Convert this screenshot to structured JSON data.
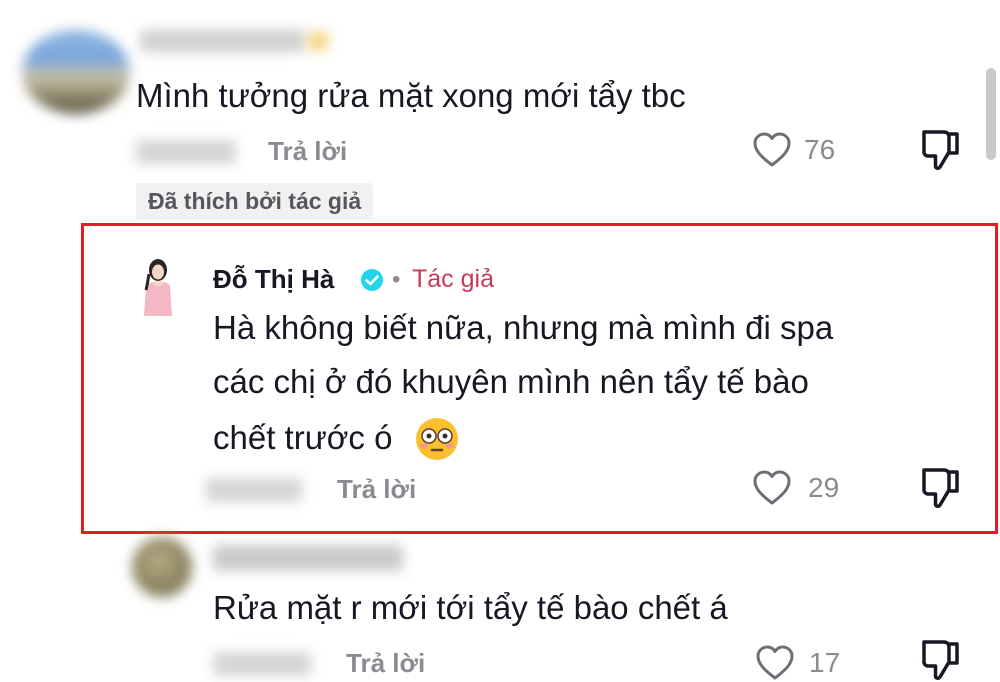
{
  "comments": [
    {
      "text": "Mình tưởng rửa mặt xong mới tẩy tbc",
      "reply_label": "Trả lời",
      "likes": "76",
      "liked_by_author_label": "Đã thích bởi tác giả"
    },
    {
      "author": "Đỗ Thị Hà",
      "verified": true,
      "separator": "•",
      "author_tag": "Tác giả",
      "text_lines": [
        "Hà không biết nữa, nhưng mà mình đi spa",
        "các chị ở đó khuyên mình nên tẩy tế bào",
        "chết trước ó"
      ],
      "emoji": "😳",
      "reply_label": "Trả lời",
      "likes": "29"
    },
    {
      "text": "Rửa mặt r mới tới tẩy tế bào chết á",
      "reply_label": "Trả lời",
      "likes": "17"
    }
  ],
  "colors": {
    "highlight_border": "#e51c23",
    "author_tag": "#c73a5a",
    "verified_badge": "#20d5ec",
    "muted_text": "#8a8b91"
  }
}
